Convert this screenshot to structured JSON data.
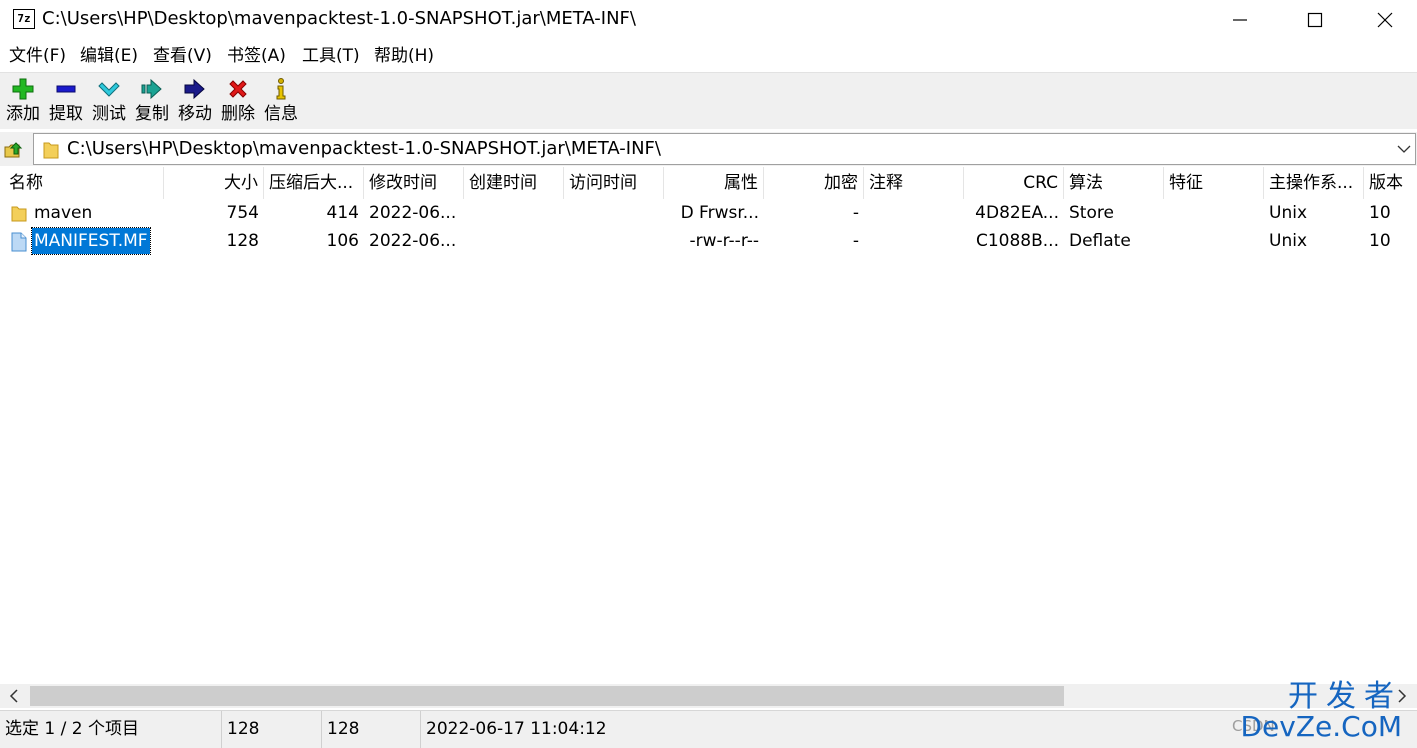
{
  "window": {
    "title": "C:\\Users\\HP\\Desktop\\mavenpacktest-1.0-SNAPSHOT.jar\\META-INF\\",
    "app_icon_text": "7z"
  },
  "menu": [
    "文件(F)",
    "编辑(E)",
    "查看(V)",
    "书签(A)",
    "工具(T)",
    "帮助(H)"
  ],
  "toolbar": {
    "items": [
      {
        "label": "添加",
        "icon": "plus-icon",
        "color": "#1aa31a"
      },
      {
        "label": "提取",
        "icon": "minus-icon",
        "color": "#1a1acc"
      },
      {
        "label": "测试",
        "icon": "check-icon",
        "color": "#1ab3c8"
      },
      {
        "label": "复制",
        "icon": "copy-arrow-icon",
        "color": "#169b8c"
      },
      {
        "label": "移动",
        "icon": "move-arrow-icon",
        "color": "#1a1a7a"
      },
      {
        "label": "删除",
        "icon": "delete-x-icon",
        "color": "#e01010"
      },
      {
        "label": "信息",
        "icon": "info-icon",
        "color": "#c8a800"
      }
    ]
  },
  "address": {
    "path": "C:\\Users\\HP\\Desktop\\mavenpacktest-1.0-SNAPSHOT.jar\\META-INF\\"
  },
  "columns": [
    "名称",
    "大小",
    "压缩后大...",
    "修改时间",
    "创建时间",
    "访问时间",
    "属性",
    "加密",
    "注释",
    "CRC",
    "算法",
    "特征",
    "主操作系...",
    "版本"
  ],
  "rows": [
    {
      "type": "folder",
      "icon": "folder-icon",
      "selected": false,
      "cells": [
        "maven",
        "754",
        "414",
        "2022-06...",
        "",
        "",
        "D Frwsr...",
        "-",
        "",
        "4D82EA...",
        "Store",
        "",
        "Unix",
        "10"
      ]
    },
    {
      "type": "file",
      "icon": "file-icon",
      "selected": true,
      "cells": [
        "MANIFEST.MF",
        "128",
        "106",
        "2022-06...",
        "",
        "",
        "-rw-r--r--",
        "-",
        "",
        "C1088B...",
        "Deflate",
        "",
        "Unix",
        "10"
      ]
    }
  ],
  "status": {
    "selection": "选定 1 / 2 个项目",
    "size": "128",
    "packed": "128",
    "modified": "2022-06-17 11:04:12"
  },
  "watermark": {
    "line1": "开发者",
    "line2": "CSDN",
    "line3": "DevZe.CoM"
  }
}
